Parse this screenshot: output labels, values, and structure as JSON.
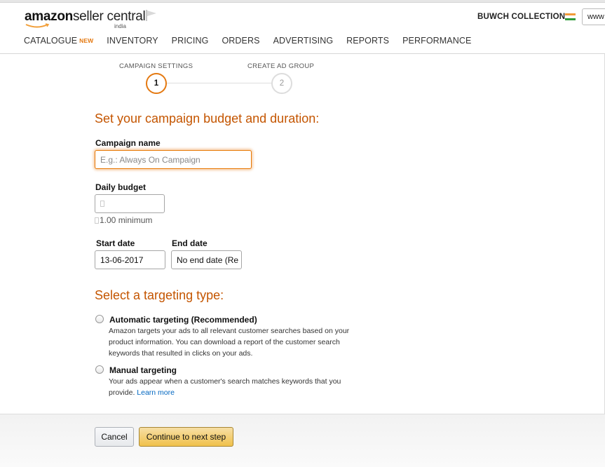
{
  "header": {
    "logo_primary": "amazon",
    "logo_secondary": "seller central",
    "logo_region": "india",
    "store_name": "BUWCH COLLECTION",
    "site_select_value": "www",
    "nav": [
      {
        "label": "CATALOGUE",
        "badge": "NEW"
      },
      {
        "label": "INVENTORY"
      },
      {
        "label": "PRICING"
      },
      {
        "label": "ORDERS"
      },
      {
        "label": "ADVERTISING"
      },
      {
        "label": "REPORTS"
      },
      {
        "label": "PERFORMANCE"
      }
    ]
  },
  "stepper": {
    "steps": [
      {
        "label": "CAMPAIGN SETTINGS",
        "number": "1",
        "state": "active"
      },
      {
        "label": "CREATE AD GROUP",
        "number": "2",
        "state": "inactive"
      }
    ]
  },
  "budget_section": {
    "title": "Set your campaign budget and duration:",
    "campaign_name_label": "Campaign name",
    "campaign_name_placeholder": "E.g.: Always On Campaign",
    "campaign_name_value": "",
    "daily_budget_label": "Daily budget",
    "daily_budget_value": "",
    "daily_budget_hint": "1.00 minimum",
    "start_date_label": "Start date",
    "start_date_value": "13-06-2017",
    "end_date_label": "End date",
    "end_date_value": "No end date (Re"
  },
  "targeting_section": {
    "title": "Select a targeting type:",
    "options": [
      {
        "title": "Automatic targeting (Recommended)",
        "description": "Amazon targets your ads to all relevant customer searches based on your product information. You can download a report of the customer search keywords that resulted in clicks on your ads."
      },
      {
        "title": "Manual targeting",
        "description": "Your ads appear when a customer's search matches keywords that you provide.",
        "link": "Learn more"
      }
    ]
  },
  "footer": {
    "cancel_label": "Cancel",
    "continue_label": "Continue to next step"
  },
  "colors": {
    "accent_orange": "#e47911",
    "heading_orange": "#c45500",
    "link_blue": "#0066c0",
    "primary_button": "#f0c14b"
  },
  "icons": {
    "flag": "flag-icon",
    "country_flag": "india-flag-icon",
    "smile": "amazon-smile-icon"
  }
}
